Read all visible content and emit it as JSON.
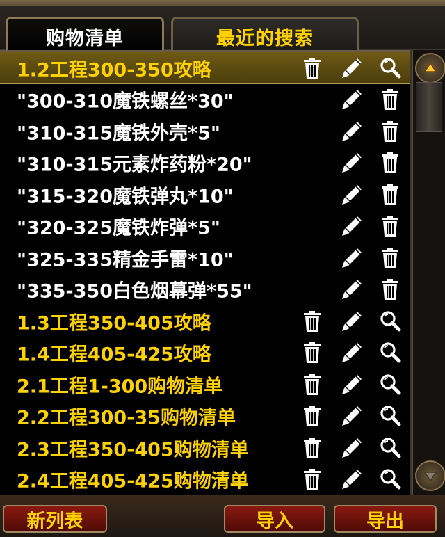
{
  "tabs": [
    {
      "label": "购物清单",
      "active": true
    },
    {
      "label": "最近的搜索",
      "active": false
    }
  ],
  "rows": [
    {
      "label": "1.2工程300-350攻略",
      "kind": "group",
      "selected": true
    },
    {
      "label": "\"300-310魔铁螺丝*30\"",
      "kind": "item",
      "selected": false
    },
    {
      "label": "\"310-315魔铁外壳*5\"",
      "kind": "item",
      "selected": false
    },
    {
      "label": "\"310-315元素炸药粉*20\"",
      "kind": "item",
      "selected": false
    },
    {
      "label": "\"315-320魔铁弹丸*10\"",
      "kind": "item",
      "selected": false
    },
    {
      "label": "\"320-325魔铁炸弹*5\"",
      "kind": "item",
      "selected": false
    },
    {
      "label": "\"325-335精金手雷*10\"",
      "kind": "item",
      "selected": false
    },
    {
      "label": "\"335-350白色烟幕弹*55\"",
      "kind": "item",
      "selected": false
    },
    {
      "label": "1.3工程350-405攻略",
      "kind": "group",
      "selected": false
    },
    {
      "label": "1.4工程405-425攻略",
      "kind": "group",
      "selected": false
    },
    {
      "label": "2.1工程1-300购物清单",
      "kind": "group",
      "selected": false
    },
    {
      "label": "2.2工程300-35购物清单",
      "kind": "group",
      "selected": false
    },
    {
      "label": "2.3工程350-405购物清单",
      "kind": "group",
      "selected": false
    },
    {
      "label": "2.4工程405-425购物清单",
      "kind": "group",
      "selected": false
    }
  ],
  "icons": {
    "trash": "trash-icon",
    "edit": "pencil-icon",
    "search": "magnifier-icon"
  },
  "buttons": {
    "new_list": "新列表",
    "import": "导入",
    "export": "导出"
  },
  "colors": {
    "gold": "#ffd100",
    "white": "#ffffff",
    "button_red": "#8a1a10"
  }
}
